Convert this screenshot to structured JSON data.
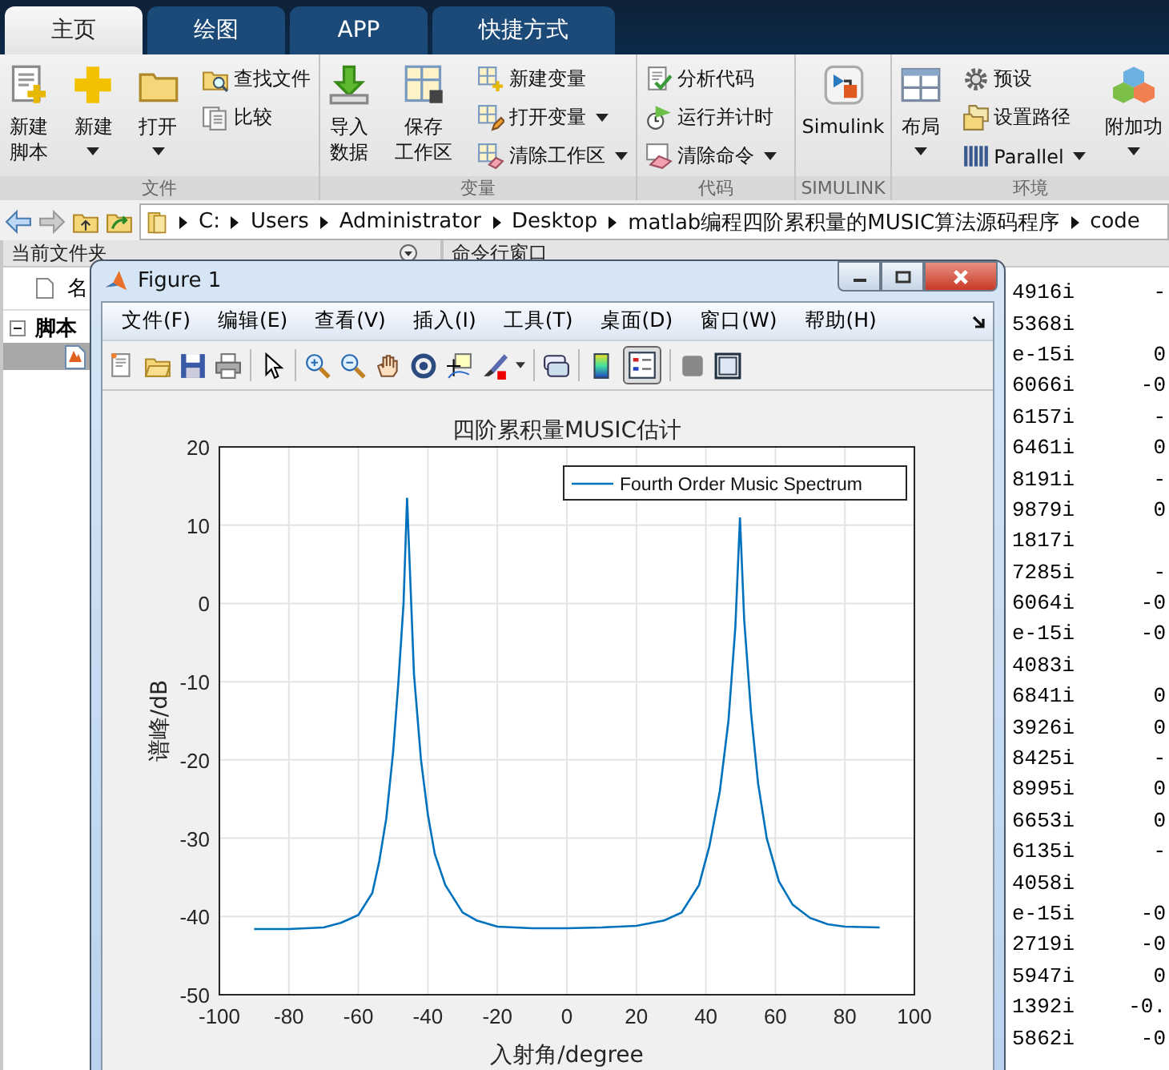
{
  "tabs": [
    {
      "label": "主页",
      "selected": true
    },
    {
      "label": "绘图",
      "selected": false
    },
    {
      "label": "APP",
      "selected": false
    },
    {
      "label": "快捷方式",
      "selected": false
    }
  ],
  "toolstrip": {
    "groups": [
      {
        "title": "文件",
        "items": [
          {
            "kind": "large",
            "label": [
              "新建",
              "脚本"
            ],
            "dropdown": false
          },
          {
            "kind": "large",
            "label": [
              "新建"
            ],
            "dropdown": true
          },
          {
            "kind": "large",
            "label": [
              "打开"
            ],
            "dropdown": true
          },
          {
            "kind": "stack",
            "items": [
              {
                "label": "查找文件",
                "dropdown": false
              },
              {
                "label": "比较",
                "dropdown": false
              }
            ]
          }
        ]
      },
      {
        "title": "变量",
        "items": [
          {
            "kind": "large",
            "label": [
              "导入",
              "数据"
            ],
            "dropdown": false
          },
          {
            "kind": "large",
            "label": [
              "保存",
              "工作区"
            ],
            "dropdown": false
          },
          {
            "kind": "stack",
            "items": [
              {
                "label": "新建变量",
                "dropdown": false
              },
              {
                "label": "打开变量",
                "dropdown": true
              },
              {
                "label": "清除工作区",
                "dropdown": true
              }
            ]
          }
        ]
      },
      {
        "title": "代码",
        "items": [
          {
            "kind": "stack",
            "items": [
              {
                "label": "分析代码",
                "dropdown": false
              },
              {
                "label": "运行并计时",
                "dropdown": false
              },
              {
                "label": "清除命令",
                "dropdown": true
              }
            ]
          }
        ]
      },
      {
        "title": "SIMULINK",
        "items": [
          {
            "kind": "large",
            "label": [
              "Simulink"
            ],
            "dropdown": false
          }
        ]
      },
      {
        "title": "环境",
        "items": [
          {
            "kind": "large",
            "label": [
              "布局"
            ],
            "dropdown": true
          },
          {
            "kind": "stack",
            "items": [
              {
                "label": "预设",
                "dropdown": false
              },
              {
                "label": "设置路径",
                "dropdown": false
              },
              {
                "label": "Parallel",
                "dropdown": true
              }
            ]
          },
          {
            "kind": "large",
            "label": [
              "附加功"
            ],
            "dropdown": true
          }
        ]
      }
    ]
  },
  "address_bar": {
    "path": [
      "C:",
      "Users",
      "Administrator",
      "Desktop",
      "matlab编程四阶累积量的MUSIC算法源码程序",
      "code"
    ]
  },
  "current_folder": {
    "title": "当前文件夹",
    "column": "名",
    "tree": [
      {
        "label": "脚本",
        "expanded": true,
        "files": [
          {
            "selected": true
          }
        ]
      }
    ]
  },
  "command_window": {
    "title": "命令行窗口",
    "lines": [
      {
        "a": "4916i",
        "b": "-"
      },
      {
        "a": "5368i"
      },
      {
        "a": "e-15i",
        "b": "0"
      },
      {
        "a": "6066i",
        "b": "-0"
      },
      {
        "a": "6157i",
        "b": "-"
      },
      {
        "a": "6461i",
        "b": "0"
      },
      {
        "a": "8191i",
        "b": "-"
      },
      {
        "a": "9879i",
        "b": "0"
      },
      {
        "a": "1817i"
      },
      {
        "a": "7285i",
        "b": "-"
      },
      {
        "a": "6064i",
        "b": "-0"
      },
      {
        "a": "e-15i",
        "b": "-0"
      },
      {
        "a": "4083i"
      },
      {
        "a": "6841i",
        "b": "0"
      },
      {
        "a": "3926i",
        "b": "0"
      },
      {
        "a": "8425i",
        "b": "-"
      },
      {
        "a": "8995i",
        "b": "0"
      },
      {
        "a": "6653i",
        "b": "0"
      },
      {
        "a": "6135i",
        "b": "-"
      },
      {
        "a": "4058i"
      },
      {
        "a": "e-15i",
        "b": "-0"
      },
      {
        "a": "2719i",
        "b": "-0"
      },
      {
        "a": "5947i",
        "b": "0"
      },
      {
        "a": "1392i",
        "b": "-0."
      },
      {
        "a": "5862i",
        "b": "-0"
      }
    ]
  },
  "figure": {
    "title": "Figure 1",
    "menu": [
      "文件(F)",
      "编辑(E)",
      "查看(V)",
      "插入(I)",
      "工具(T)",
      "桌面(D)",
      "窗口(W)",
      "帮助(H)"
    ],
    "legend_toggle": {
      "on": true
    },
    "chart_data": {
      "type": "line",
      "title": "四阶累积量MUSIC估计",
      "xlabel": "入射角/degree",
      "ylabel": "谱峰/dB",
      "grid": true,
      "x": [
        -90,
        -80,
        -70,
        -65,
        -60,
        -56,
        -54,
        -52,
        -50,
        -48.5,
        -47,
        -46,
        -45,
        -44,
        -42,
        -40,
        -38,
        -35,
        -30,
        -26,
        -20,
        -10,
        0,
        10,
        20,
        28,
        33,
        38,
        41,
        44,
        46.5,
        48.5,
        49.8,
        51,
        53,
        55,
        57.5,
        61,
        65,
        70,
        75,
        80,
        90
      ],
      "series": [
        {
          "name": "Fourth Order Music Spectrum",
          "color": "#0072bd",
          "values": [
            -41.6,
            -41.6,
            -41.4,
            -40.8,
            -39.8,
            -37,
            -33,
            -27.5,
            -19,
            -10,
            0,
            13.5,
            2,
            -9,
            -20,
            -27,
            -32,
            -36,
            -39.5,
            -40.5,
            -41.3,
            -41.5,
            -41.5,
            -41.4,
            -41.2,
            -40.5,
            -39.5,
            -36,
            -31,
            -24,
            -15,
            -3,
            11,
            -2,
            -14,
            -23,
            -30,
            -35.5,
            -38.5,
            -40.2,
            -41,
            -41.3,
            -41.4
          ]
        }
      ],
      "xlim": [
        -100,
        100
      ],
      "ylim": [
        -50,
        20
      ],
      "xticks": [
        -100,
        -80,
        -60,
        -40,
        -20,
        0,
        20,
        40,
        60,
        80,
        100
      ],
      "yticks": [
        -50,
        -40,
        -30,
        -20,
        -10,
        0,
        10,
        20
      ]
    }
  }
}
